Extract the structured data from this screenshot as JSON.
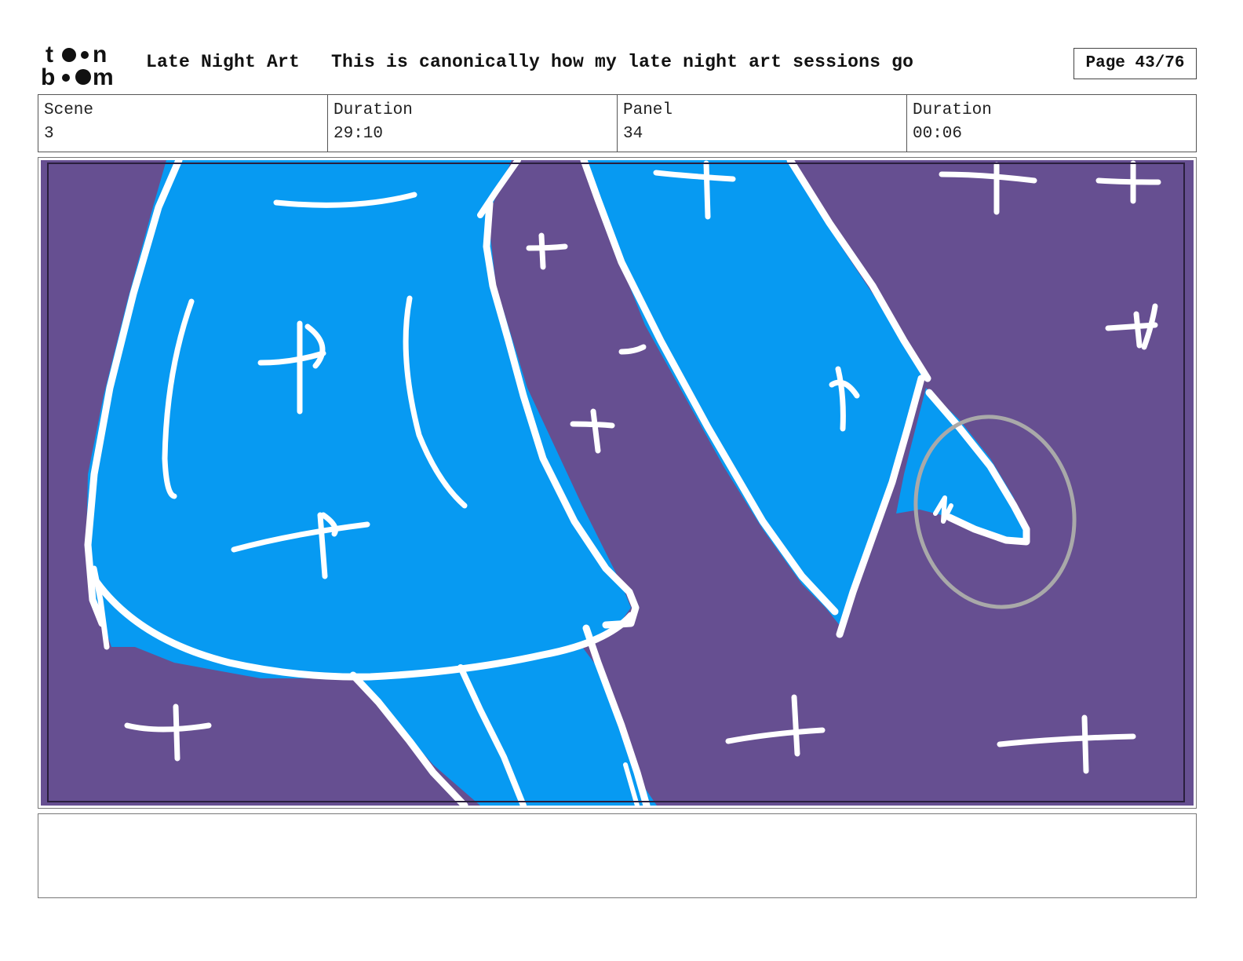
{
  "header": {
    "logo_text": "toon boom",
    "project_title": "Late Night Art",
    "project_subtitle": "This is canonically how my late night art sessions go",
    "page_label": "Page 43/76"
  },
  "info": {
    "scene_label": "Scene",
    "scene_value": "3",
    "scene_duration_label": "Duration",
    "scene_duration_value": "29:10",
    "panel_label": "Panel",
    "panel_value": "34",
    "panel_duration_label": "Duration",
    "panel_duration_value": "00:06"
  },
  "panel": {
    "background_color": "#664f91",
    "figure_color": "#079af2",
    "line_color": "#ffffff",
    "highlight_circle_color": "#a9a9a9"
  },
  "notes": {
    "text": ""
  }
}
